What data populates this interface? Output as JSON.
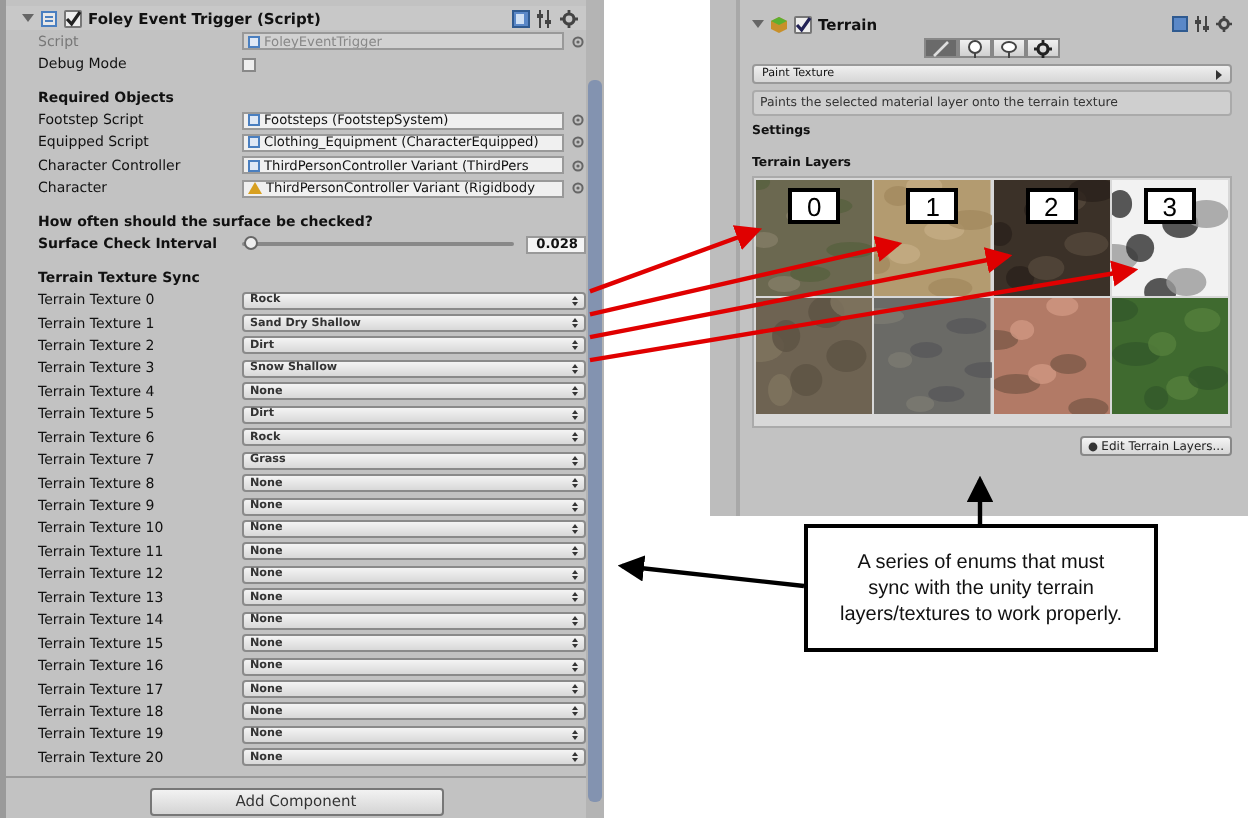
{
  "inspector": {
    "component": {
      "title": "Foley Event Trigger (Script)",
      "enabled": true,
      "expanded": true
    },
    "rows": [
      {
        "kind": "object",
        "label": "Script",
        "value": "FoleyEventTrigger",
        "prefab": false,
        "disabled": true
      },
      {
        "kind": "checkbox",
        "label": "Debug Mode",
        "checked": false
      },
      {
        "kind": "header",
        "label": "Required Objects"
      },
      {
        "kind": "object",
        "label": "Footstep Script",
        "value": "Footsteps (FootstepSystem)",
        "prefab": false,
        "disabled": false
      },
      {
        "kind": "object",
        "label": "Equipped Script",
        "value": "Clothing_Equipment (CharacterEquipped)",
        "prefab": false,
        "disabled": false
      },
      {
        "kind": "object",
        "label": "Character Controller",
        "value": "ThirdPersonController Variant (ThirdPers",
        "prefab": false,
        "disabled": false
      },
      {
        "kind": "object",
        "label": "Character",
        "value": "ThirdPersonController Variant (Rigidbody",
        "prefab": true,
        "disabled": false
      },
      {
        "kind": "header",
        "label": "How often should the surface be checked?"
      },
      {
        "kind": "slider",
        "label": "Surface Check Interval",
        "level": 0.028,
        "reading": "0.028"
      },
      {
        "kind": "header",
        "label": "Terrain Texture Sync"
      },
      {
        "kind": "enum",
        "label": "Terrain Texture 0",
        "value": "Rock"
      },
      {
        "kind": "enum",
        "label": "Terrain Texture 1",
        "value": "Sand Dry Shallow"
      },
      {
        "kind": "enum",
        "label": "Terrain Texture 2",
        "value": "Dirt"
      },
      {
        "kind": "enum",
        "label": "Terrain Texture 3",
        "value": "Snow Shallow"
      },
      {
        "kind": "enum",
        "label": "Terrain Texture 4",
        "value": "None"
      },
      {
        "kind": "enum",
        "label": "Terrain Texture 5",
        "value": "Dirt"
      },
      {
        "kind": "enum",
        "label": "Terrain Texture 6",
        "value": "Rock"
      },
      {
        "kind": "enum",
        "label": "Terrain Texture 7",
        "value": "Grass"
      },
      {
        "kind": "enum",
        "label": "Terrain Texture 8",
        "value": "None"
      },
      {
        "kind": "enum",
        "label": "Terrain Texture 9",
        "value": "None"
      },
      {
        "kind": "enum",
        "label": "Terrain Texture 10",
        "value": "None"
      },
      {
        "kind": "enum",
        "label": "Terrain Texture 11",
        "value": "None"
      },
      {
        "kind": "enum",
        "label": "Terrain Texture 12",
        "value": "None"
      },
      {
        "kind": "enum",
        "label": "Terrain Texture 13",
        "value": "None"
      },
      {
        "kind": "enum",
        "label": "Terrain Texture 14",
        "value": "None"
      },
      {
        "kind": "enum",
        "label": "Terrain Texture 15",
        "value": "None"
      },
      {
        "kind": "enum",
        "label": "Terrain Texture 16",
        "value": "None"
      },
      {
        "kind": "enum",
        "label": "Terrain Texture 17",
        "value": "None"
      },
      {
        "kind": "enum",
        "label": "Terrain Texture 18",
        "value": "None"
      },
      {
        "kind": "enum",
        "label": "Terrain Texture 19",
        "value": "None"
      },
      {
        "kind": "enum",
        "label": "Terrain Texture 20",
        "value": "None"
      }
    ],
    "add_button": "Add Component"
  },
  "terrain": {
    "title": "Terrain",
    "enabled": true,
    "tools": [
      {
        "selected": true
      },
      {
        "selected": false
      },
      {
        "selected": false
      },
      {
        "selected": false
      }
    ],
    "mode": "Paint Texture",
    "description": "Paints the selected material layer onto the terrain texture",
    "settings_label": "Settings",
    "layers_label": "Terrain Layers",
    "layers": [
      {
        "kind": "picture",
        "tag": "0"
      },
      {
        "kind": "picture",
        "tag": "1"
      },
      {
        "kind": "picture",
        "tag": "2"
      },
      {
        "kind": "picture",
        "tag": "3"
      },
      {
        "kind": "picture"
      },
      {
        "kind": "picture"
      },
      {
        "kind": "picture"
      },
      {
        "kind": "picture"
      }
    ],
    "edit_button": "Edit Terrain Layers..."
  },
  "callout": "A series of enums that must sync with the unity terrain layers/textures to work properly."
}
